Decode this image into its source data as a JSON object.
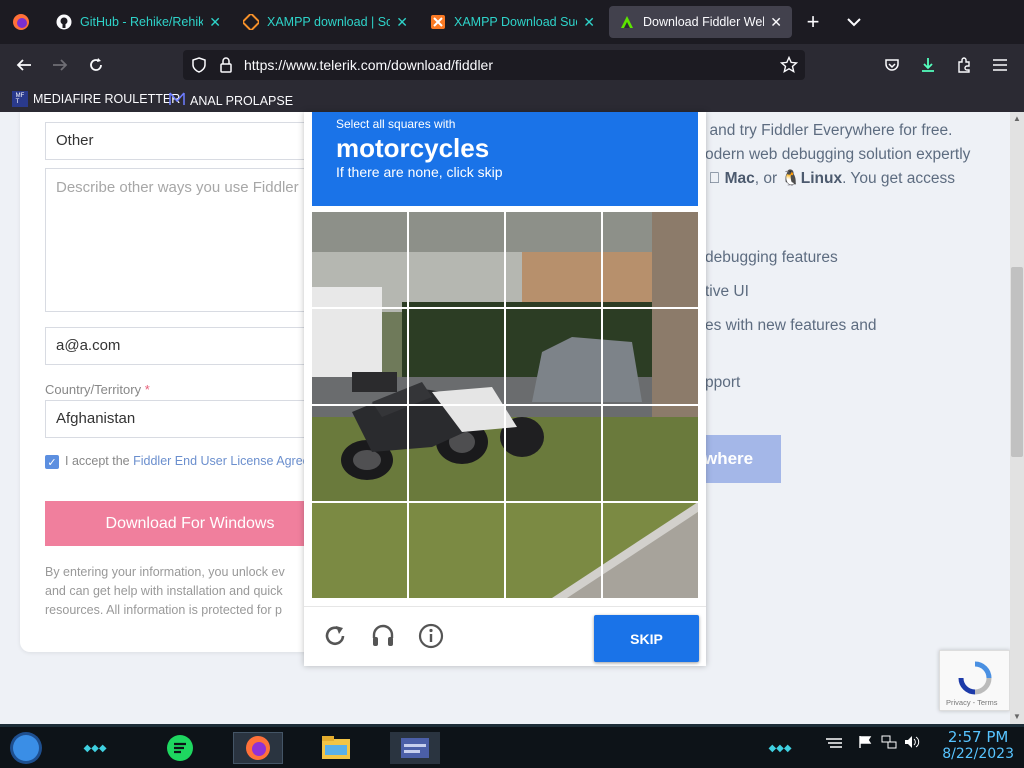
{
  "browser": {
    "tabs": [
      {
        "title": "GitHub - Rehike/Rehike",
        "icon": "github-icon",
        "close": "✕"
      },
      {
        "title": "XAMPP download | Sou",
        "icon": "xampp-icon",
        "close": "✕"
      },
      {
        "title": "XAMPP Download Succe",
        "icon": "xampp-icon",
        "close": "✕"
      },
      {
        "title": "Download Fiddler Web D",
        "icon": "fiddler-icon",
        "close": "✕"
      }
    ],
    "url": "https://www.telerik.com/download/fiddler",
    "bookmarks": [
      "MEDIAFIRE ROULETTER",
      "ANAL PROLAPSE"
    ],
    "new_tab": "+"
  },
  "form": {
    "use_value": "Other",
    "describe_placeholder": "Describe other ways you use Fiddler",
    "email_value": "a@a.com",
    "country_label": "Country/Territory",
    "required_mark": "*",
    "country_value": "Afghanistan",
    "accept_text": "I accept the ",
    "accept_link": "Fiddler End User License Agree",
    "download_button": "Download For Windows",
    "fine_print_1": "By entering your information, you unlock ev",
    "fine_print_2": "and can get help with installation and quick",
    "fine_print_3": "resources. All information is protected for p"
  },
  "right_content": {
    "line1": "r and try Fiddler Everywhere for free.",
    "line2": "odern web debugging solution expertly",
    "line3_mac": "Mac",
    "line3_or": ", or ",
    "line3_linux": "Linux",
    "line3_tail": ". You get access",
    "feature1": "debugging features",
    "feature2": "tive UI",
    "feature3": "es with new features and",
    "feature4": "pport",
    "button": "where"
  },
  "captcha": {
    "select_text": "Select all squares with",
    "target": "motorcycles",
    "instruction": "If there are none, click skip",
    "skip_button": "SKIP",
    "icons": [
      "reload-icon",
      "audio-icon",
      "info-icon"
    ]
  },
  "recaptcha_badge": {
    "text": "Privacy - Terms"
  },
  "taskbar": {
    "time": "2:57 PM",
    "date": "8/22/2023"
  },
  "colors": {
    "captcha_blue": "#1a73e8",
    "download_pink": "#f07f9d",
    "clock_color": "#57c4ff"
  }
}
